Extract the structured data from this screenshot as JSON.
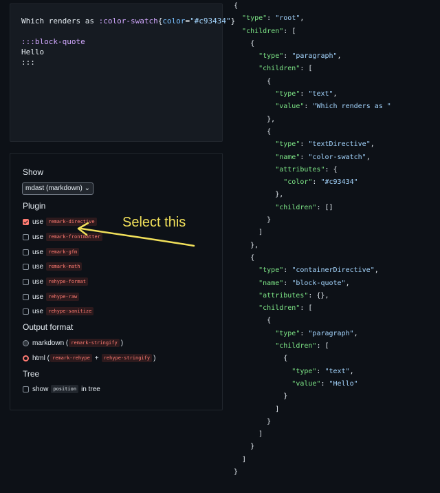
{
  "editor": {
    "line1_text": "Which renders as ",
    "line1_dir": ":color-swatch",
    "line1_open": "{",
    "line1_attr": "color",
    "line1_eq": "=",
    "line1_val": "\"#c93434\"",
    "line1_close": "}",
    "line3": ":::block-quote",
    "line4": "Hello",
    "line5": ":::"
  },
  "options": {
    "show_heading": "Show",
    "show_select": "mdast (markdown)",
    "plugin_heading": "Plugin",
    "use_label": "use",
    "plugins": [
      {
        "name": "remark-directive",
        "checked": true
      },
      {
        "name": "remark-frontmatter",
        "checked": false
      },
      {
        "name": "remark-gfm",
        "checked": false
      },
      {
        "name": "remark-math",
        "checked": false
      },
      {
        "name": "rehype-format",
        "checked": false
      },
      {
        "name": "rehype-raw",
        "checked": false
      },
      {
        "name": "rehype-sanitize",
        "checked": false
      }
    ],
    "output_heading": "Output format",
    "output_markdown": "markdown (",
    "output_markdown_pkg": "remark-stringify",
    "output_markdown_end": ")",
    "output_html": "html (",
    "output_html_pkg1": "remark-rehype",
    "output_plus": "+",
    "output_html_pkg2": "rehype-stringify",
    "output_html_end": ")",
    "tree_heading": "Tree",
    "tree_show": "show",
    "tree_position": "position",
    "tree_in_tree": "in tree"
  },
  "annotation": {
    "text": "Select this",
    "color": "#f1e05a"
  },
  "json_lines": [
    "{",
    "  \"type\": \"root\",",
    "  \"children\": [",
    "    {",
    "      \"type\": \"paragraph\",",
    "      \"children\": [",
    "        {",
    "          \"type\": \"text\",",
    "          \"value\": \"Which renders as \"",
    "        },",
    "        {",
    "          \"type\": \"textDirective\",",
    "          \"name\": \"color-swatch\",",
    "          \"attributes\": {",
    "            \"color\": \"#c93434\"",
    "          },",
    "          \"children\": []",
    "        }",
    "      ]",
    "    },",
    "    {",
    "      \"type\": \"containerDirective\",",
    "      \"name\": \"block-quote\",",
    "      \"attributes\": {},",
    "      \"children\": [",
    "        {",
    "          \"type\": \"paragraph\",",
    "          \"children\": [",
    "            {",
    "              \"type\": \"text\",",
    "              \"value\": \"Hello\"",
    "            }",
    "          ]",
    "        }",
    "      ]",
    "    }",
    "  ]",
    "}"
  ]
}
